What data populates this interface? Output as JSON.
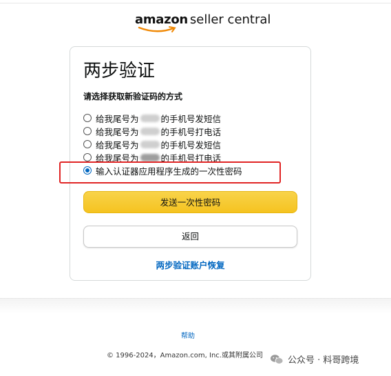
{
  "header": {
    "brand_amazon": "amazon",
    "brand_rest": "seller central"
  },
  "card": {
    "title": "两步验证",
    "subtitle": "请选择获取新验证码的方式",
    "options": [
      {
        "prefix": "给我尾号为",
        "suffix": "的手机号发短信",
        "selected": false
      },
      {
        "prefix": "给我尾号为",
        "suffix": "的手机号打电话",
        "selected": false
      },
      {
        "prefix": "给我尾号为",
        "suffix": "的手机号发短信",
        "selected": false
      },
      {
        "prefix": "给我尾号为",
        "suffix": "的手机号打电话",
        "selected": false
      },
      {
        "prefix": "",
        "suffix": "输入认证器应用程序生成的一次性密码",
        "selected": true
      }
    ],
    "send_button": "发送一次性密码",
    "back_button": "返回",
    "recovery_link": "两步验证账户恢复"
  },
  "footer": {
    "help": "帮助",
    "copyright": "© 1996-2024，Amazon.com, Inc.或其附属公司"
  },
  "watermark": {
    "text": "公众号 · 料哥跨境"
  },
  "colors": {
    "accent": "#0066c0",
    "primary_button": "#f5c320",
    "highlight_box": "#e02424"
  }
}
